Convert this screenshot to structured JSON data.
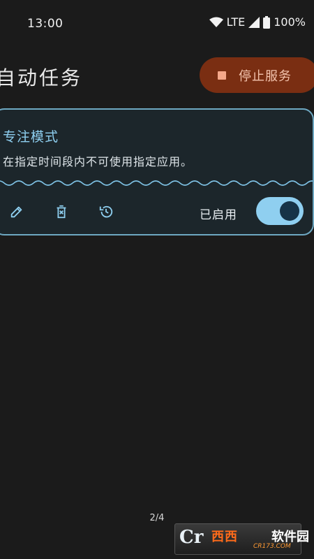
{
  "status_bar": {
    "time": "13:00",
    "network": "LTE",
    "battery": "100%",
    "icons": [
      "wifi-icon",
      "signal-icon",
      "battery-icon"
    ]
  },
  "header": {
    "title": "自动任务",
    "stop_button_label": "停止服务",
    "stop_icon": "stop-square-icon"
  },
  "tasks": [
    {
      "title": "专注模式",
      "description": "在指定时间段内不可使用指定应用。",
      "actions": [
        "edit-icon",
        "delete-icon",
        "history-icon"
      ],
      "enabled_label": "已启用",
      "enabled": true
    }
  ],
  "pager": "2/4",
  "watermark": {
    "logo": "Cr",
    "brand": "西西",
    "brand_suffix": "软件园",
    "site": "CR173.COM"
  },
  "colors": {
    "background": "#1b1b1b",
    "accent": "#8ecff0",
    "stop_button": "#7a2e12",
    "card_border": "#6ea8c2"
  }
}
